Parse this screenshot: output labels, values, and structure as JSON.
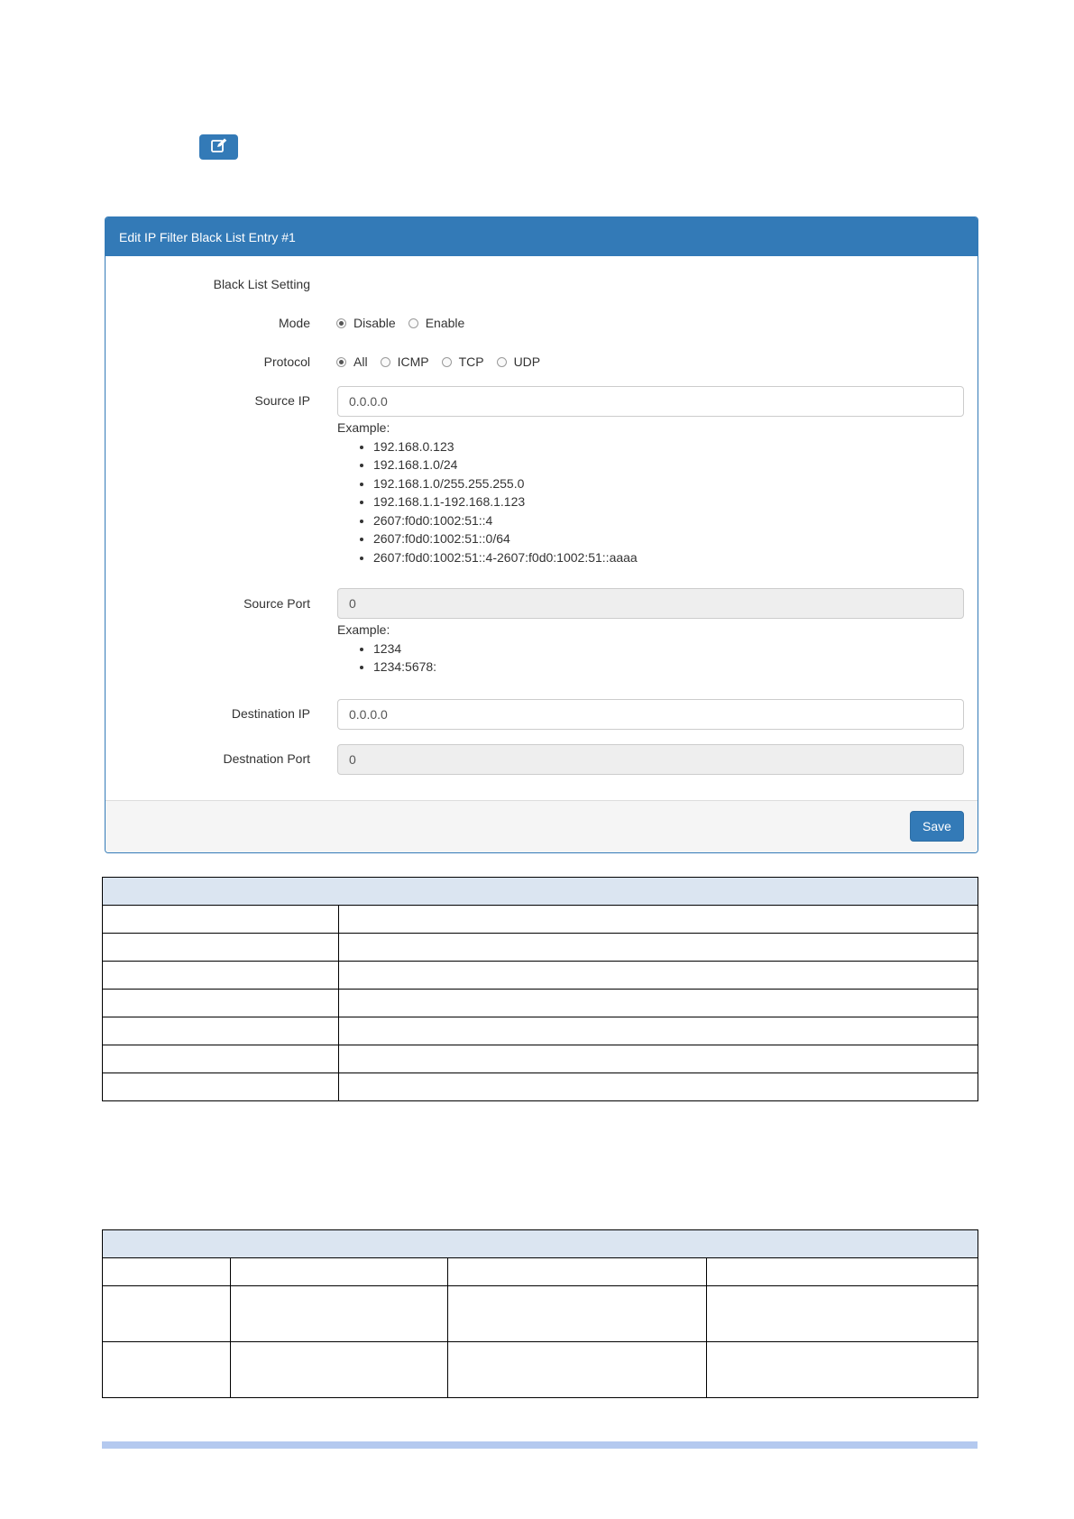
{
  "edit_button": {
    "icon": "edit-icon"
  },
  "panel": {
    "title": "Edit IP Filter Black List Entry #1",
    "section_title": "Black List Setting",
    "mode": {
      "label": "Mode",
      "options": [
        "Disable",
        "Enable"
      ],
      "selected": "Disable"
    },
    "protocol": {
      "label": "Protocol",
      "options": [
        "All",
        "ICMP",
        "TCP",
        "UDP"
      ],
      "selected": "All"
    },
    "source_ip": {
      "label": "Source IP",
      "value": "0.0.0.0",
      "example_label": "Example:",
      "examples": [
        "192.168.0.123",
        "192.168.1.0/24",
        "192.168.1.0/255.255.255.0",
        "192.168.1.1-192.168.1.123",
        "2607:f0d0:1002:51::4",
        "2607:f0d0:1002:51::0/64",
        "2607:f0d0:1002:51::4-2607:f0d0:1002:51::aaaa"
      ]
    },
    "source_port": {
      "label": "Source Port",
      "value": "0",
      "example_label": "Example:",
      "examples": [
        "1234",
        "1234:5678:"
      ]
    },
    "destination_ip": {
      "label": "Destination IP",
      "value": "0.0.0.0"
    },
    "destination_port": {
      "label": "Destnation Port",
      "value": "0"
    },
    "save_label": "Save"
  },
  "colors": {
    "primary": "#337ab7",
    "table_header": "#dbe5f1",
    "footer_bar": "#b4c9ef"
  }
}
